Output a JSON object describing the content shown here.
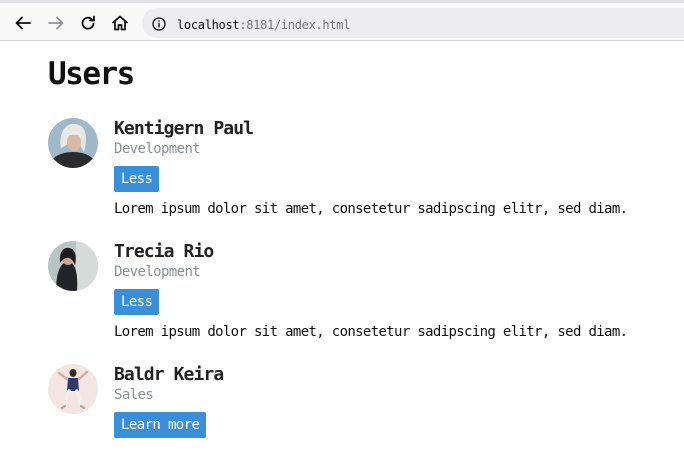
{
  "browser": {
    "url_host": "localhost",
    "url_rest": ":8181/index.html"
  },
  "page": {
    "title": "Users"
  },
  "users": [
    {
      "name": "Kentigern Paul",
      "department": "Development",
      "button_label": "Less",
      "description": "Lorem ipsum dolor sit amet, consetetur sadipscing elitr, sed diam."
    },
    {
      "name": "Trecia Rio",
      "department": "Development",
      "button_label": "Less",
      "description": "Lorem ipsum dolor sit amet, consetetur sadipscing elitr, sed diam."
    },
    {
      "name": "Baldr Keira",
      "department": "Sales",
      "button_label": "Learn more"
    }
  ],
  "colors": {
    "button_bg": "#3a8fdb",
    "department_text": "#8a8f94"
  }
}
